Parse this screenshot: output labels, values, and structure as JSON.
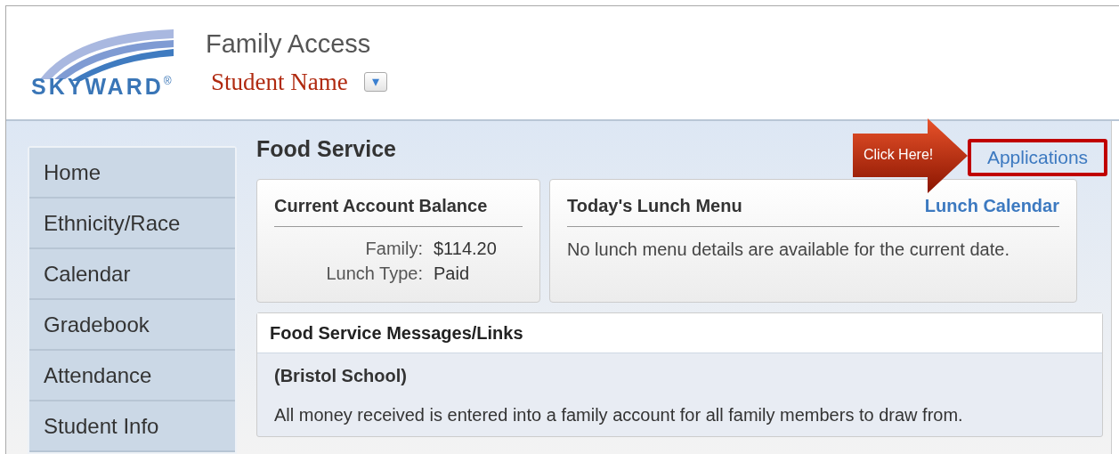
{
  "header": {
    "logo": {
      "wordmark": "SKYWARD",
      "registered": "®"
    },
    "title": "Family Access",
    "student": {
      "name": "Student Name",
      "dropdown": "▾"
    }
  },
  "sidebar": {
    "items": [
      {
        "label": "Home"
      },
      {
        "label": "Ethnicity/Race"
      },
      {
        "label": "Calendar"
      },
      {
        "label": "Gradebook"
      },
      {
        "label": "Attendance"
      },
      {
        "label": "Student Info"
      }
    ]
  },
  "page": {
    "title": "Food Service",
    "link": "Applications",
    "callout": "Click Here!"
  },
  "balance_card": {
    "title": "Current Account Balance",
    "fields": [
      {
        "label": "Family:",
        "value": "$114.20"
      },
      {
        "label": "Lunch Type:",
        "value": "Paid"
      }
    ]
  },
  "lunch_card": {
    "title": "Today's Lunch Menu",
    "link": "Lunch Calendar",
    "message": "No lunch menu details are available for the current date."
  },
  "messages": {
    "title": "Food Service Messages/Links",
    "school": "(Bristol School)",
    "text": "All money received is entered into a family account for all family members to draw from."
  }
}
